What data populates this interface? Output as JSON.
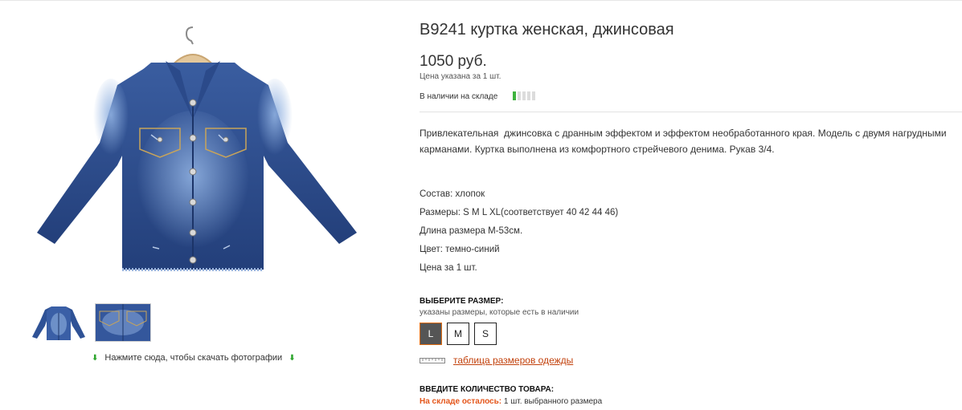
{
  "product": {
    "title": "B9241 куртка женская, джинсовая",
    "price": "1050 руб.",
    "price_note": "Цена указана за 1 шт.",
    "stock_label": "В наличии на складе",
    "stock_level": 0.2,
    "description": "Привлекательная  джинсовка с дранным эффектом и эффектом необработанного края. Модель с двумя нагрудными карманами. Куртка выполнена из комфортного стрейчевого денима. Рукав 3/4.",
    "specs": [
      "Состав: хлопок",
      "Размеры: S M L XL(соответствует 40 42 44 46)",
      "Длина размера M-53см.",
      "Цвет: темно-синий",
      "Цена за 1 шт."
    ]
  },
  "gallery": {
    "download_text": "Нажмите сюда, чтобы скачать фотографии"
  },
  "size_picker": {
    "heading": "ВЫБЕРИТЕ РАЗМЕР:",
    "subheading": "указаны размеры, которые есть в наличии",
    "sizes": [
      "L",
      "M",
      "S"
    ],
    "selected": "L",
    "size_table_link": "таблица размеров одежды"
  },
  "quantity": {
    "heading": "ВВЕДИТЕ КОЛИЧЕСТВО ТОВАРА:",
    "left_label": "На складе осталось:",
    "left_value": "1 шт. выбранного размера"
  },
  "colors": {
    "accent": "#e06a10",
    "link": "#c2410c",
    "stock_on": "#3fb33f",
    "denim": "#2f4f8f"
  }
}
